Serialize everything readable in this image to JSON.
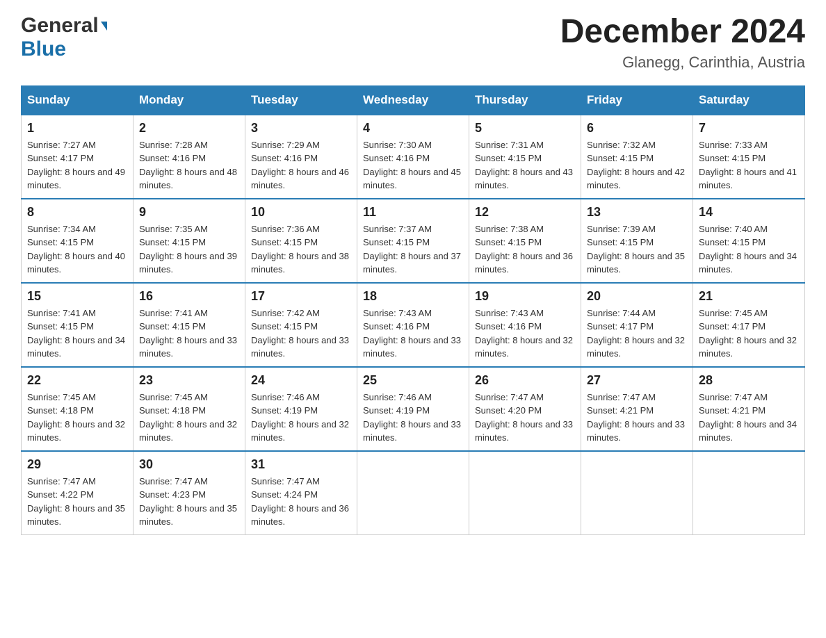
{
  "header": {
    "logo_general": "General",
    "logo_blue": "Blue",
    "month_title": "December 2024",
    "location": "Glanegg, Carinthia, Austria"
  },
  "days_of_week": [
    "Sunday",
    "Monday",
    "Tuesday",
    "Wednesday",
    "Thursday",
    "Friday",
    "Saturday"
  ],
  "weeks": [
    [
      {
        "day": "1",
        "sunrise": "7:27 AM",
        "sunset": "4:17 PM",
        "daylight": "8 hours and 49 minutes."
      },
      {
        "day": "2",
        "sunrise": "7:28 AM",
        "sunset": "4:16 PM",
        "daylight": "8 hours and 48 minutes."
      },
      {
        "day": "3",
        "sunrise": "7:29 AM",
        "sunset": "4:16 PM",
        "daylight": "8 hours and 46 minutes."
      },
      {
        "day": "4",
        "sunrise": "7:30 AM",
        "sunset": "4:16 PM",
        "daylight": "8 hours and 45 minutes."
      },
      {
        "day": "5",
        "sunrise": "7:31 AM",
        "sunset": "4:15 PM",
        "daylight": "8 hours and 43 minutes."
      },
      {
        "day": "6",
        "sunrise": "7:32 AM",
        "sunset": "4:15 PM",
        "daylight": "8 hours and 42 minutes."
      },
      {
        "day": "7",
        "sunrise": "7:33 AM",
        "sunset": "4:15 PM",
        "daylight": "8 hours and 41 minutes."
      }
    ],
    [
      {
        "day": "8",
        "sunrise": "7:34 AM",
        "sunset": "4:15 PM",
        "daylight": "8 hours and 40 minutes."
      },
      {
        "day": "9",
        "sunrise": "7:35 AM",
        "sunset": "4:15 PM",
        "daylight": "8 hours and 39 minutes."
      },
      {
        "day": "10",
        "sunrise": "7:36 AM",
        "sunset": "4:15 PM",
        "daylight": "8 hours and 38 minutes."
      },
      {
        "day": "11",
        "sunrise": "7:37 AM",
        "sunset": "4:15 PM",
        "daylight": "8 hours and 37 minutes."
      },
      {
        "day": "12",
        "sunrise": "7:38 AM",
        "sunset": "4:15 PM",
        "daylight": "8 hours and 36 minutes."
      },
      {
        "day": "13",
        "sunrise": "7:39 AM",
        "sunset": "4:15 PM",
        "daylight": "8 hours and 35 minutes."
      },
      {
        "day": "14",
        "sunrise": "7:40 AM",
        "sunset": "4:15 PM",
        "daylight": "8 hours and 34 minutes."
      }
    ],
    [
      {
        "day": "15",
        "sunrise": "7:41 AM",
        "sunset": "4:15 PM",
        "daylight": "8 hours and 34 minutes."
      },
      {
        "day": "16",
        "sunrise": "7:41 AM",
        "sunset": "4:15 PM",
        "daylight": "8 hours and 33 minutes."
      },
      {
        "day": "17",
        "sunrise": "7:42 AM",
        "sunset": "4:15 PM",
        "daylight": "8 hours and 33 minutes."
      },
      {
        "day": "18",
        "sunrise": "7:43 AM",
        "sunset": "4:16 PM",
        "daylight": "8 hours and 33 minutes."
      },
      {
        "day": "19",
        "sunrise": "7:43 AM",
        "sunset": "4:16 PM",
        "daylight": "8 hours and 32 minutes."
      },
      {
        "day": "20",
        "sunrise": "7:44 AM",
        "sunset": "4:17 PM",
        "daylight": "8 hours and 32 minutes."
      },
      {
        "day": "21",
        "sunrise": "7:45 AM",
        "sunset": "4:17 PM",
        "daylight": "8 hours and 32 minutes."
      }
    ],
    [
      {
        "day": "22",
        "sunrise": "7:45 AM",
        "sunset": "4:18 PM",
        "daylight": "8 hours and 32 minutes."
      },
      {
        "day": "23",
        "sunrise": "7:45 AM",
        "sunset": "4:18 PM",
        "daylight": "8 hours and 32 minutes."
      },
      {
        "day": "24",
        "sunrise": "7:46 AM",
        "sunset": "4:19 PM",
        "daylight": "8 hours and 32 minutes."
      },
      {
        "day": "25",
        "sunrise": "7:46 AM",
        "sunset": "4:19 PM",
        "daylight": "8 hours and 33 minutes."
      },
      {
        "day": "26",
        "sunrise": "7:47 AM",
        "sunset": "4:20 PM",
        "daylight": "8 hours and 33 minutes."
      },
      {
        "day": "27",
        "sunrise": "7:47 AM",
        "sunset": "4:21 PM",
        "daylight": "8 hours and 33 minutes."
      },
      {
        "day": "28",
        "sunrise": "7:47 AM",
        "sunset": "4:21 PM",
        "daylight": "8 hours and 34 minutes."
      }
    ],
    [
      {
        "day": "29",
        "sunrise": "7:47 AM",
        "sunset": "4:22 PM",
        "daylight": "8 hours and 35 minutes."
      },
      {
        "day": "30",
        "sunrise": "7:47 AM",
        "sunset": "4:23 PM",
        "daylight": "8 hours and 35 minutes."
      },
      {
        "day": "31",
        "sunrise": "7:47 AM",
        "sunset": "4:24 PM",
        "daylight": "8 hours and 36 minutes."
      },
      null,
      null,
      null,
      null
    ]
  ],
  "labels": {
    "sunrise_prefix": "Sunrise: ",
    "sunset_prefix": "Sunset: ",
    "daylight_prefix": "Daylight: "
  }
}
